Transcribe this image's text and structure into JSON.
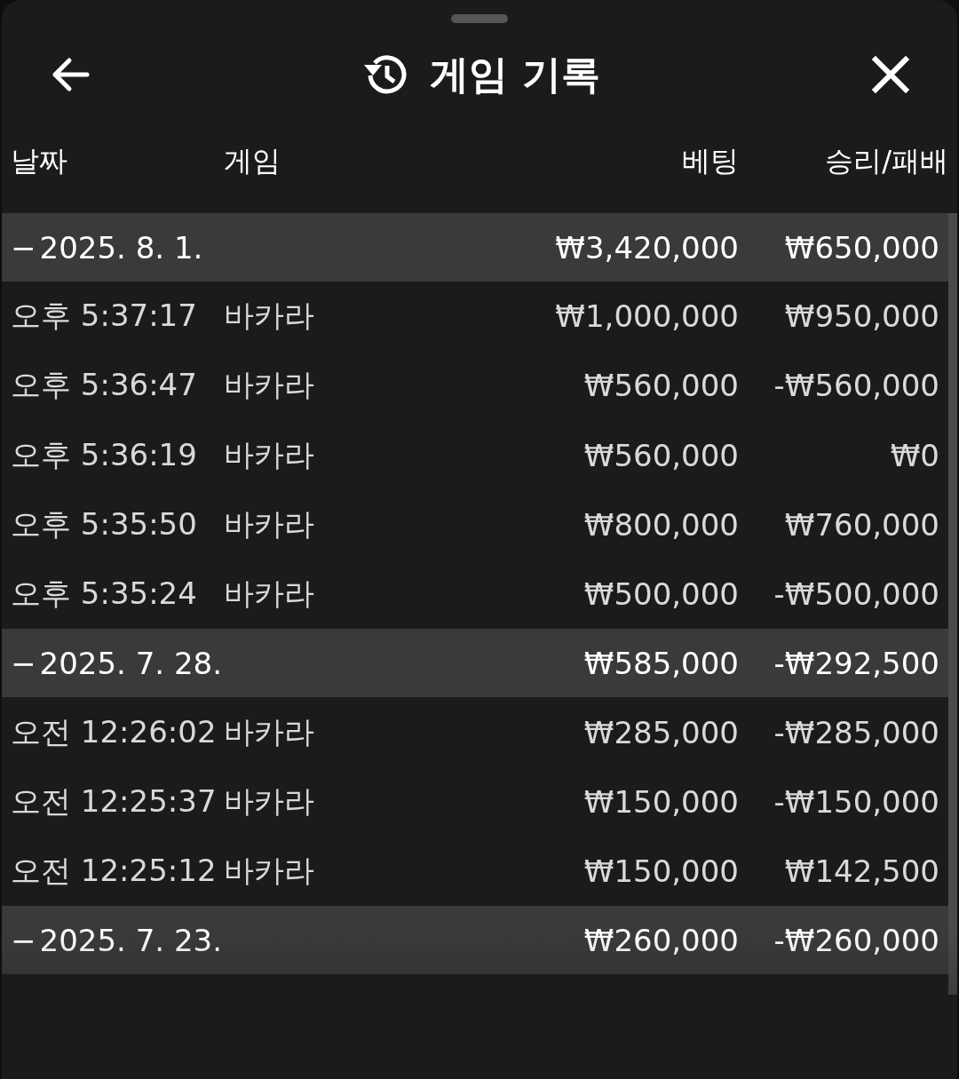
{
  "header": {
    "title": "게임 기록"
  },
  "table": {
    "columns": [
      "날짜",
      "게임",
      "베팅",
      "승리/패배"
    ],
    "groups": [
      {
        "toggle": "−",
        "date": "2025. 8. 1.",
        "bet": "₩3,420,000",
        "result": "₩650,000",
        "rows": [
          {
            "time": "오후 5:37:17",
            "game": "바카라",
            "bet": "₩1,000,000",
            "result": "₩950,000"
          },
          {
            "time": "오후 5:36:47",
            "game": "바카라",
            "bet": "₩560,000",
            "result": "-₩560,000"
          },
          {
            "time": "오후 5:36:19",
            "game": "바카라",
            "bet": "₩560,000",
            "result": "₩0"
          },
          {
            "time": "오후 5:35:50",
            "game": "바카라",
            "bet": "₩800,000",
            "result": "₩760,000"
          },
          {
            "time": "오후 5:35:24",
            "game": "바카라",
            "bet": "₩500,000",
            "result": "-₩500,000"
          }
        ]
      },
      {
        "toggle": "−",
        "date": "2025. 7. 28.",
        "bet": "₩585,000",
        "result": "-₩292,500",
        "rows": [
          {
            "time": "오전 12:26:02",
            "game": "바카라",
            "bet": "₩285,000",
            "result": "-₩285,000"
          },
          {
            "time": "오전 12:25:37",
            "game": "바카라",
            "bet": "₩150,000",
            "result": "-₩150,000"
          },
          {
            "time": "오전 12:25:12",
            "game": "바카라",
            "bet": "₩150,000",
            "result": "₩142,500"
          }
        ]
      },
      {
        "toggle": "−",
        "date": "2025. 7. 23.",
        "bet": "₩260,000",
        "result": "-₩260,000"
      }
    ]
  }
}
